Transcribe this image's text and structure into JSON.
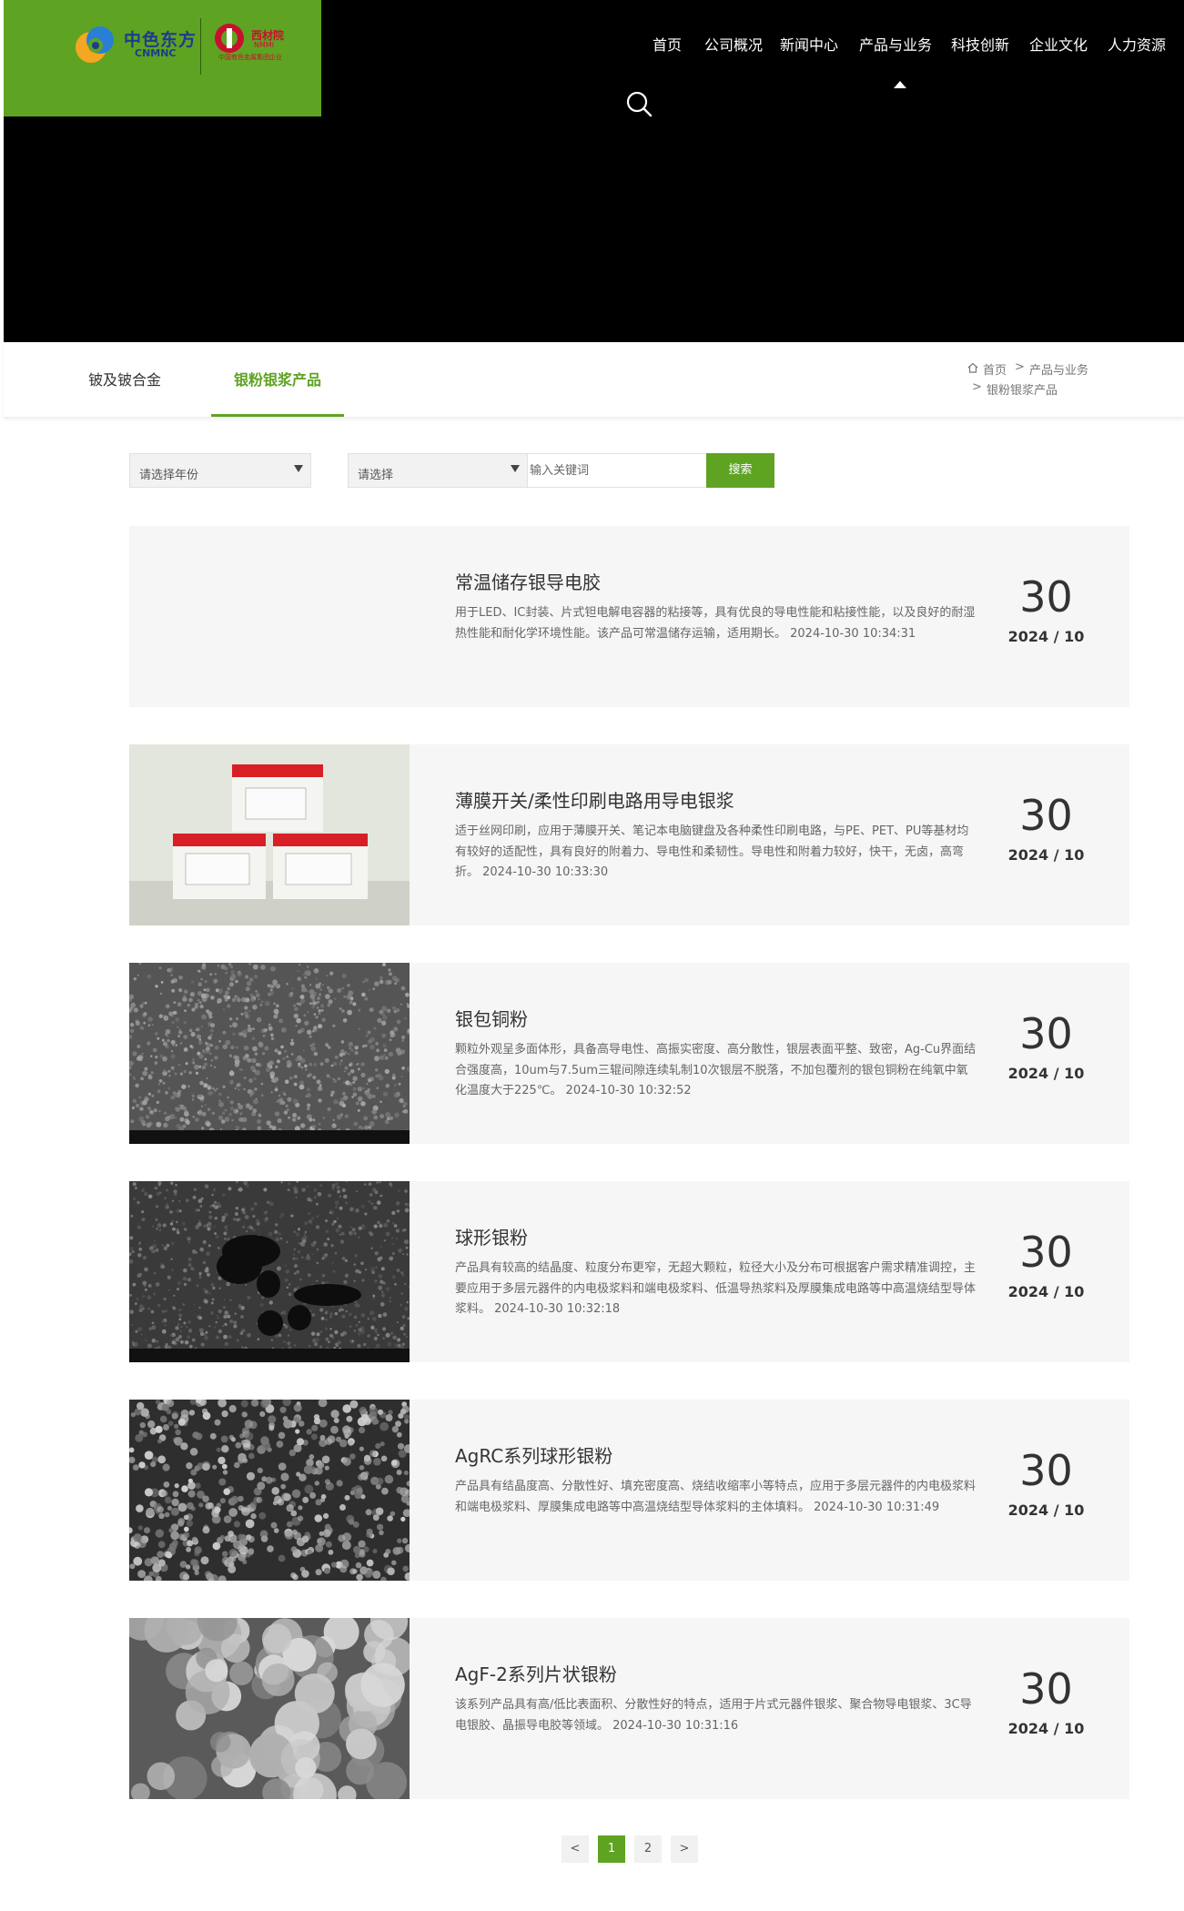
{
  "header": {
    "logo": {
      "brand_cn": "中色东方",
      "brand_en": "CNMNC",
      "partner_cn": "西材院",
      "partner_en": "NMMI",
      "partner_sub": "中国有色金属集团企业"
    },
    "nav": [
      "首页",
      "公司概况",
      "新闻中心",
      "产品与业务",
      "科技创新",
      "企业文化",
      "人力资源"
    ],
    "active_nav": "产品与业务"
  },
  "subnav": {
    "tabs": [
      "铍及铍合金",
      "银粉银浆产品"
    ],
    "active_tab": "银粉银浆产品",
    "breadcrumb": {
      "home": "首页",
      "sep1": ">",
      "section": "产品与业务",
      "sep2": ">",
      "current": "银粉银浆产品"
    }
  },
  "filter": {
    "year_select": "请选择年份",
    "type_select": "请选择",
    "keyword_placeholder": "输入关键词",
    "search_label": "搜索"
  },
  "products": [
    {
      "title": "常温储存银导电胶",
      "desc": "用于LED、IC封装、片式钽电解电容器的粘接等，具有优良的导电性能和粘接性能，以及良好的耐湿热性能和耐化学环境性能。该产品可常温储存运输，适用期长。 2024-10-30 10:34:31",
      "day": "30",
      "ym": "2024 / 10",
      "image": "none"
    },
    {
      "title": "薄膜开关/柔性印刷电路用导电银浆",
      "desc": "适于丝网印刷，应用于薄膜开关、笔记本电脑键盘及各种柔性印刷电路，与PE、PET、PU等基材均有较好的适配性，具有良好的附着力、导电性和柔韧性。导电性和附着力较好，快干，无卤，高弯折。 2024-10-30 10:33:30",
      "day": "30",
      "ym": "2024 / 10",
      "image": "paste-jars"
    },
    {
      "title": "银包铜粉",
      "desc": "颗粒外观呈多面体形，具备高导电性、高振实密度、高分散性，银层表面平整、致密，Ag-Cu界面结合强度高，10um与7.5um三辊间隙连续轧制10次银层不脱落，不加包覆剂的银包铜粉在纯氧中氧化温度大于225℃。 2024-10-30 10:32:52",
      "day": "30",
      "ym": "2024 / 10",
      "image": "sem-fine"
    },
    {
      "title": "球形银粉",
      "desc": "产品具有较高的结晶度、粒度分布更窄，无超大颗粒，粒径大小及分布可根据客户需求精准调控，主要应用于多层元器件的内电极浆料和端电极浆料、低温导热浆料及厚膜集成电路等中高温烧结型导体浆料。 2024-10-30 10:32:18",
      "day": "30",
      "ym": "2024 / 10",
      "image": "sem-dark"
    },
    {
      "title": "AgRC系列球形银粉",
      "desc": "产品具有结晶度高、分散性好、填充密度高、烧结收缩率小等特点，应用于多层元器件的内电极浆料和端电极浆料、厚膜集成电路等中高温烧结型导体浆料的主体填料。 2024-10-30 10:31:49",
      "day": "30",
      "ym": "2024 / 10",
      "image": "sem-sphere"
    },
    {
      "title": "AgF-2系列片状银粉",
      "desc": "该系列产品具有高/低比表面积、分散性好的特点，适用于片式元器件银浆、聚合物导电银浆、3C导电银胶、晶振导电胶等领域。 2024-10-30 10:31:16",
      "day": "30",
      "ym": "2024 / 10",
      "image": "sem-flake"
    }
  ],
  "pagination": {
    "prev": "<",
    "pages": [
      "1",
      "2"
    ],
    "current": "1",
    "next": ">"
  },
  "colors": {
    "brand_green": "#5fa322",
    "hero_bg": "#000000",
    "card_bg": "#f6f6f6"
  }
}
